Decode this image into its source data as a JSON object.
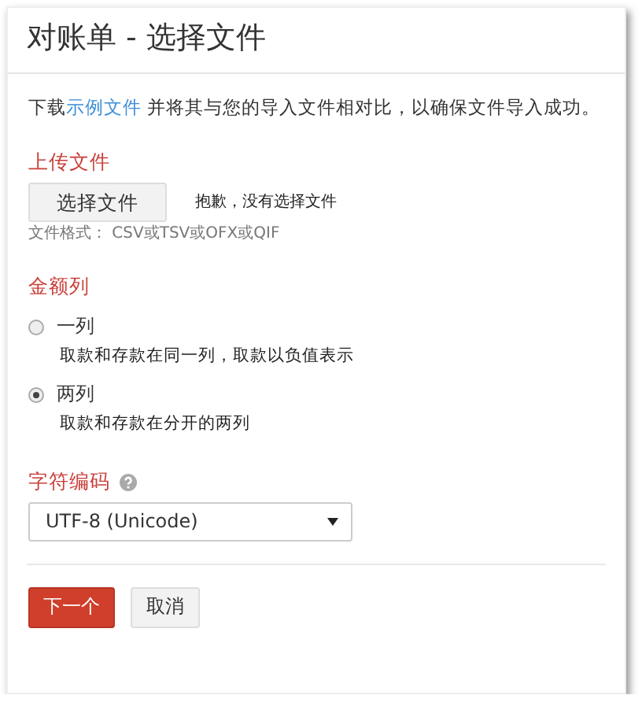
{
  "dialog": {
    "title": "对账单 - 选择文件"
  },
  "intro": {
    "before": "下载",
    "link": "示例文件",
    "after": " 并将其与您的导入文件相对比，以确保文件导入成功。"
  },
  "upload": {
    "heading": "上传文件",
    "button": "选择文件",
    "status": "抱歉，没有选择文件",
    "formats": "文件格式： CSV或TSV或OFX或QIF"
  },
  "amount_columns": {
    "heading": "金额列",
    "options": [
      {
        "label": "一列",
        "description": "取款和存款在同一列，取款以负值表示",
        "selected": false
      },
      {
        "label": "两列",
        "description": "取款和存款在分开的两列",
        "selected": true
      }
    ]
  },
  "encoding": {
    "heading": "字符编码",
    "value": "UTF-8 (Unicode)"
  },
  "buttons": {
    "next": "下一个",
    "cancel": "取消"
  }
}
